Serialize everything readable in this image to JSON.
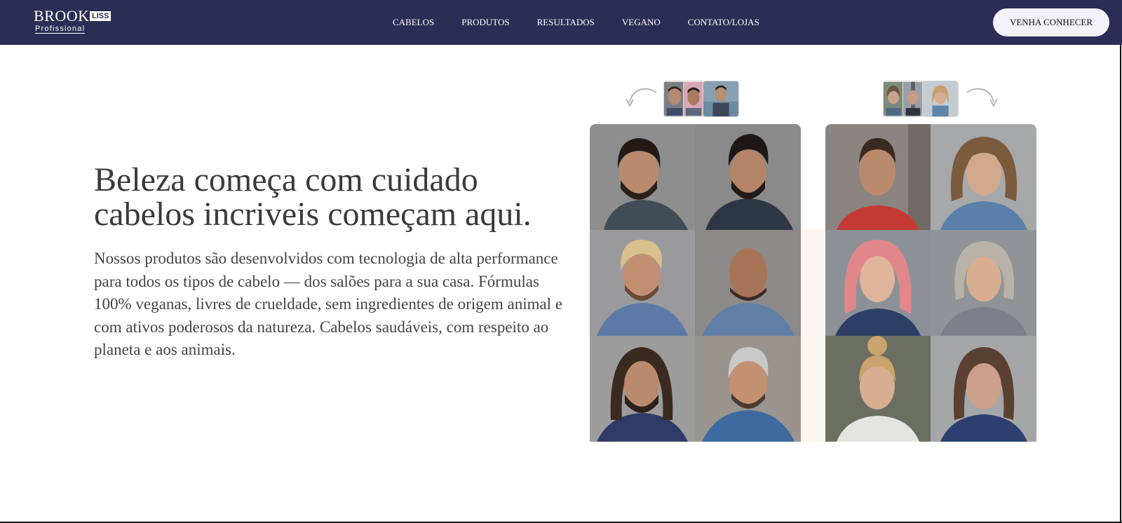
{
  "brand": {
    "name": "BROOK",
    "badge": "LISS",
    "tagline": "Profissional",
    "primary_color": "#2c2d55"
  },
  "nav": {
    "items": [
      "CABELOS",
      "PRODUTOS",
      "RESULTADOS",
      "VEGANO",
      "CONTATO/LOJAS"
    ]
  },
  "cta": {
    "label": "VENHA CONHECER"
  },
  "hero": {
    "title_line1": "Beleza começa com cuidado",
    "title_line2": "cabelos incriveis começam aqui.",
    "description": "Nossos produtos são desenvolvidos com tecnologia de alta performance para todos os tipos de cabelo — dos salões para a sua casa. Fórmulas 100% veganas, livres de crueldade, sem ingredientes de origem animal e com ativos poderosos da natureza. Cabelos saudáveis, com respeito ao planeta e aos animais."
  },
  "icons": {
    "arrow_left": "curved-arrow-left-icon",
    "arrow_right": "curved-arrow-right-icon"
  }
}
